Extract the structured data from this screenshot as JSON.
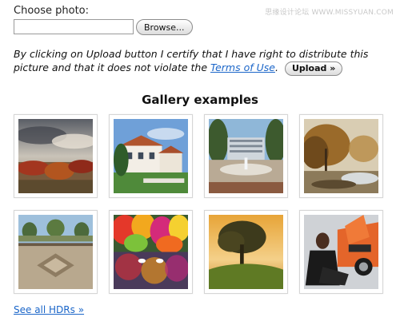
{
  "watermark": "思缘设计论坛  WWW.MISSYUAN.COM",
  "upload": {
    "label": "Choose photo:",
    "file_value": "",
    "browse_label": "Browse...",
    "disclaimer_before": "By clicking on Upload button I certify that I have right to distribute this picture and that it does not violate the ",
    "terms_link": "Terms of Use",
    "disclaimer_after": ".",
    "upload_label": "Upload »"
  },
  "gallery": {
    "title": "Gallery examples",
    "items": [
      {
        "subject": "stormy sky over red autumn trees"
      },
      {
        "subject": "white villa with terracotta roofs"
      },
      {
        "subject": "plaza with fountains and buildings"
      },
      {
        "subject": "golden trees by misty water"
      },
      {
        "subject": "stone plaza with mosaic and trees"
      },
      {
        "subject": "colorful autumn forest reflected in lake with swans"
      },
      {
        "subject": "lone tree on hill at sunset"
      },
      {
        "subject": "man sitting next to orange sports car"
      }
    ],
    "see_all_label": "See all HDRs »"
  },
  "colors": {
    "link": "#1b66c9",
    "thumb_border": "#d6d6d6"
  }
}
